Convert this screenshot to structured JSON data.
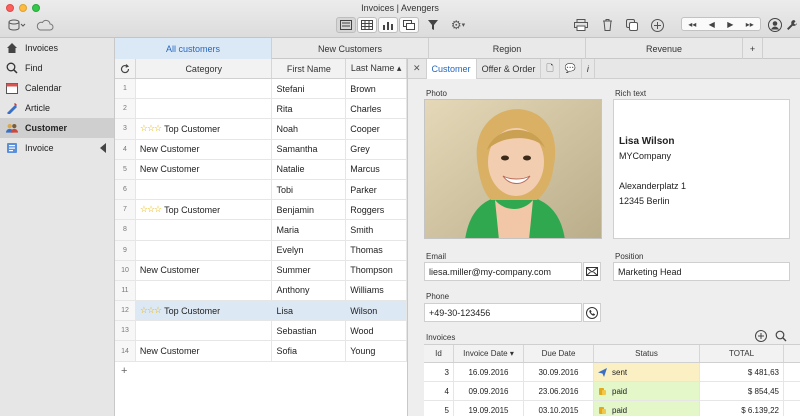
{
  "window": {
    "title": "Invoices | Avengers"
  },
  "sidebar": {
    "items": [
      {
        "label": "Invoices",
        "icon": "home-icon"
      },
      {
        "label": "Find",
        "icon": "search-icon"
      },
      {
        "label": "Calendar",
        "icon": "calendar-icon"
      },
      {
        "label": "Article",
        "icon": "article-icon"
      },
      {
        "label": "Customer",
        "icon": "customer-icon"
      },
      {
        "label": "Invoice",
        "icon": "invoice-icon"
      }
    ]
  },
  "tabs": [
    {
      "label": "All customers"
    },
    {
      "label": "New Customers"
    },
    {
      "label": "Region"
    },
    {
      "label": "Revenue"
    },
    {
      "label": "+"
    }
  ],
  "table": {
    "headers": {
      "category": "Category",
      "first": "First Name",
      "last": "Last Name ▴"
    },
    "rows": [
      {
        "num": "1",
        "category": "",
        "stars": "",
        "first": "Stefani",
        "last": "Brown"
      },
      {
        "num": "2",
        "category": "",
        "stars": "",
        "first": "Rita",
        "last": "Charles"
      },
      {
        "num": "3",
        "category": "Top Customer",
        "stars": "☆☆☆",
        "first": "Noah",
        "last": "Cooper"
      },
      {
        "num": "4",
        "category": "New Customer",
        "stars": "",
        "first": "Samantha",
        "last": "Grey"
      },
      {
        "num": "5",
        "category": "New Customer",
        "stars": "",
        "first": "Natalie",
        "last": "Marcus"
      },
      {
        "num": "6",
        "category": "",
        "stars": "",
        "first": "Tobi",
        "last": "Parker"
      },
      {
        "num": "7",
        "category": "Top Customer",
        "stars": "☆☆☆",
        "first": "Benjamin",
        "last": "Roggers"
      },
      {
        "num": "8",
        "category": "",
        "stars": "",
        "first": "Maria",
        "last": "Smith"
      },
      {
        "num": "9",
        "category": "",
        "stars": "",
        "first": "Evelyn",
        "last": "Thomas"
      },
      {
        "num": "10",
        "category": "New Customer",
        "stars": "",
        "first": "Summer",
        "last": "Thompson"
      },
      {
        "num": "11",
        "category": "",
        "stars": "",
        "first": "Anthony",
        "last": "Williams"
      },
      {
        "num": "12",
        "category": "Top Customer",
        "stars": "☆☆☆",
        "first": "Lisa",
        "last": "Wilson"
      },
      {
        "num": "13",
        "category": "",
        "stars": "",
        "first": "Sebastian",
        "last": "Wood"
      },
      {
        "num": "14",
        "category": "New Customer",
        "stars": "",
        "first": "Sofia",
        "last": "Young"
      }
    ],
    "add_label": "+"
  },
  "detail": {
    "tabs": [
      {
        "label": "✕"
      },
      {
        "label": "Customer"
      },
      {
        "label": "Offer & Order"
      },
      {
        "label": "🗋"
      },
      {
        "label": "💬"
      },
      {
        "label": "i"
      }
    ],
    "photo_label": "Photo",
    "richtext_label": "Rich text",
    "richtext": {
      "name": "Lisa Wilson",
      "company": "MYCompany",
      "street": "Alexanderplatz 1",
      "city": "12345 Berlin"
    },
    "email_label": "Email",
    "email": "liesa.miller@my-company.com",
    "position_label": "Position",
    "position": "Marketing Head",
    "phone_label": "Phone",
    "phone": "+49-30-123456",
    "invoices_label": "Invoices",
    "invoice_headers": {
      "id": "Id",
      "date": "Invoice Date ▾",
      "due": "Due Date",
      "status": "Status",
      "total": "TOTAL"
    },
    "invoices": [
      {
        "id": "3",
        "date": "16.09.2016",
        "due": "30.09.2016",
        "status": "sent",
        "total": "$ 481,63"
      },
      {
        "id": "4",
        "date": "09.09.2016",
        "due": "23.06.2016",
        "status": "paid",
        "total": "$ 854,45"
      },
      {
        "id": "5",
        "date": "19.09.2015",
        "due": "03.10.2015",
        "status": "paid",
        "total": "$ 6.139,22"
      }
    ]
  },
  "colors": {
    "accent": "#2767c0",
    "selected_row": "#dde8f5",
    "status_sent": "#fbf0c4",
    "status_paid": "#e3f7c9"
  }
}
